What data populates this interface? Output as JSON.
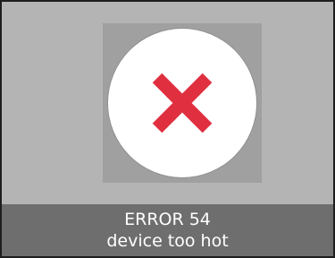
{
  "error": {
    "code_text": "ERROR 54",
    "message": "device too hot",
    "icon": "error-x-icon",
    "icon_color": "#e03040"
  },
  "colors": {
    "screen_background": "#b4b4b4",
    "icon_plate": "#a0a0a0",
    "circle": "#ffffff",
    "message_bar": "#6e6e6e",
    "message_text": "#ffffff"
  }
}
